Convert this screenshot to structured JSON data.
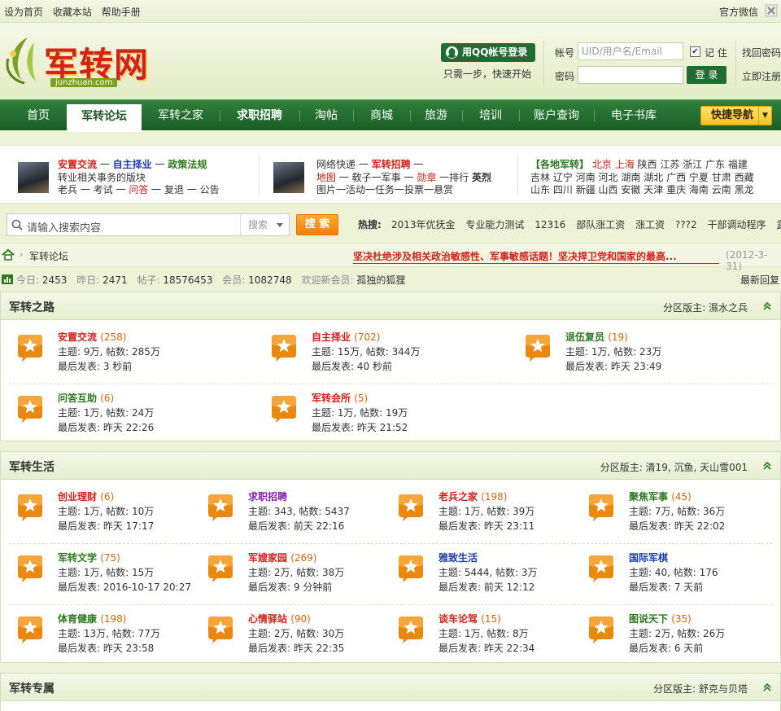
{
  "topbar": {
    "links": [
      "设为首页",
      "收藏本站",
      "帮助手册"
    ],
    "wechat": "官方微信"
  },
  "logo": {
    "text": "军转网",
    "sub": "junzhuan.com"
  },
  "login": {
    "qq_button": "用QQ帐号登录",
    "qq_tip": "只需一步，快速开始",
    "account_label": "帐号",
    "account_placeholder": "UID/用户名/Email",
    "password_label": "密码",
    "remember": "记 住",
    "remember_checked": true,
    "login_button": "登 录",
    "forgot": "找回密码",
    "register": "立即注册"
  },
  "nav": {
    "items": [
      "首页",
      "军转论坛",
      "军转之家",
      "求职招聘",
      "淘帖",
      "商城",
      "旅游",
      "培训",
      "账户查询",
      "电子书库"
    ],
    "active_index": 1,
    "quick_nav": "快捷导航"
  },
  "info": {
    "block1": {
      "row1": [
        "安置交流",
        "自主择业",
        "政策法规"
      ],
      "row2": "转业相关事务的版块",
      "row3": [
        "老兵",
        "考试",
        "问答",
        "复退",
        "公告"
      ]
    },
    "block2": {
      "row1": [
        "网络快递",
        "军转招聘"
      ],
      "row2": [
        "地图",
        "敎子一军事",
        "勋章",
        "一排行",
        "英烈"
      ],
      "row3": "图片一活动一任务一投票一悬赏"
    },
    "block3": {
      "title": "【各地军转】",
      "row1": [
        "北京",
        "上海",
        "陕西",
        "江苏",
        "浙江",
        "广东",
        "福建"
      ],
      "row2": [
        "吉林",
        "辽宁",
        "河南",
        "河北",
        "湖南",
        "湖北",
        "广西",
        "宁夏",
        "甘肃",
        "西藏"
      ],
      "row3": [
        "山东",
        "四川",
        "新疆",
        "山西",
        "安徽",
        "天津",
        "重庆",
        "海南",
        "云南",
        "黑龙"
      ]
    }
  },
  "search": {
    "placeholder": "请输入搜索内容",
    "select": "搜索",
    "button": "搜 索",
    "hot_label": "热搜:",
    "hot": [
      "2013年优抚金",
      "专业能力测试",
      "12316",
      "部队涨工资",
      "涨工资",
      "???2",
      "干部调动程序",
      "武警"
    ]
  },
  "crumb": {
    "current": "军转论坛",
    "notice": "坚决杜绝涉及相关政治敏感性、军事敏感话题！坚决捍卫党和国家的最高...",
    "notice_date": "(2012-3-31)"
  },
  "stats": {
    "today_label": "今日:",
    "today": "2453",
    "yesterday_label": "昨日:",
    "yesterday": "2471",
    "posts_label": "帖子:",
    "posts": "18576453",
    "members_label": "会员:",
    "members": "1082748",
    "welcome_label": "欢迎新会员:",
    "newest": "孤独的狐狸",
    "latest_replies": "最新回复"
  },
  "sections": [
    {
      "title": "军转之路",
      "moderator": "分区版主: 濕水之兵",
      "forums": [
        {
          "name": "安置交流",
          "count": "(258)",
          "stat": "主题: 9万, 帖数: 285万",
          "last": "最后发表: 3 秒前",
          "color": "#d3221b"
        },
        {
          "name": "自主择业",
          "count": "(702)",
          "stat": "主题: 15万, 帖数: 344万",
          "last": "最后发表: 40 秒前",
          "color": "#d3221b"
        },
        {
          "name": "退伍复员",
          "count": "(19)",
          "stat": "主题: 1万, 帖数: 23万",
          "last": "最后发表: 昨天 23:49",
          "color": "#2d7a1f"
        },
        {
          "name": "问答互助",
          "count": "(6)",
          "stat": "主题: 1万, 帖数: 24万",
          "last": "最后发表: 昨天 22:26",
          "color": "#2d7a1f"
        },
        {
          "name": "军转会所",
          "count": "(5)",
          "stat": "主题: 1万, 帖数: 19万",
          "last": "最后发表: 昨天 21:52",
          "color": "#d3221b"
        }
      ]
    },
    {
      "title": "军转生活",
      "moderator": "分区版主: 清19, 沉鱼, 天山雪001",
      "forums": [
        {
          "name": "创业理财",
          "count": "(6)",
          "stat": "主题: 1万, 帖数: 10万",
          "last": "最后发表: 昨天 17:17",
          "color": "#d3221b"
        },
        {
          "name": "求职招聘",
          "count": "",
          "stat": "主题: 343, 帖数: 5437",
          "last": "最后发表: 前天 22:16",
          "color": "#8a1fae"
        },
        {
          "name": "老兵之家",
          "count": "(198)",
          "stat": "主题: 1万, 帖数: 39万",
          "last": "最后发表: 昨天 23:11",
          "color": "#d3221b"
        },
        {
          "name": "聚焦军事",
          "count": "(45)",
          "stat": "主题: 7万, 帖数: 36万",
          "last": "最后发表: 昨天 22:02",
          "color": "#2d7a1f"
        },
        {
          "name": "军转文学",
          "count": "(75)",
          "stat": "主题: 1万, 帖数: 15万",
          "last": "最后发表: 2016-10-17 20:27",
          "color": "#2d7a1f"
        },
        {
          "name": "军嫂家园",
          "count": "(269)",
          "stat": "主题: 2万, 帖数: 38万",
          "last": "最后发表: 9 分钟前",
          "color": "#d3221b"
        },
        {
          "name": "雅致生活",
          "count": "",
          "stat": "主题: 5444, 帖数: 3万",
          "last": "最后发表: 前天 12:12",
          "color": "#1e3fae"
        },
        {
          "name": "国际军棋",
          "count": "",
          "stat": "主题: 40, 帖数: 176",
          "last": "最后发表: 7 天前",
          "color": "#1e3fae"
        },
        {
          "name": "体育健康",
          "count": "(198)",
          "stat": "主题: 13万, 帖数: 77万",
          "last": "最后发表: 昨天 23:58",
          "color": "#2d7a1f"
        },
        {
          "name": "心情驿站",
          "count": "(90)",
          "stat": "主题: 2万, 帖数: 30万",
          "last": "最后发表: 昨天 22:35",
          "color": "#d3221b"
        },
        {
          "name": "谈车论驾",
          "count": "(15)",
          "stat": "主题: 1万, 帖数: 8万",
          "last": "最后发表: 昨天 22:34",
          "color": "#d3221b"
        },
        {
          "name": "图说天下",
          "count": "(35)",
          "stat": "主题: 2万, 帖数: 26万",
          "last": "最后发表: 6 天前",
          "color": "#2d7a1f"
        }
      ]
    },
    {
      "title": "军转专属",
      "moderator": "分区版主: 舒克与贝塔",
      "forums": []
    }
  ]
}
